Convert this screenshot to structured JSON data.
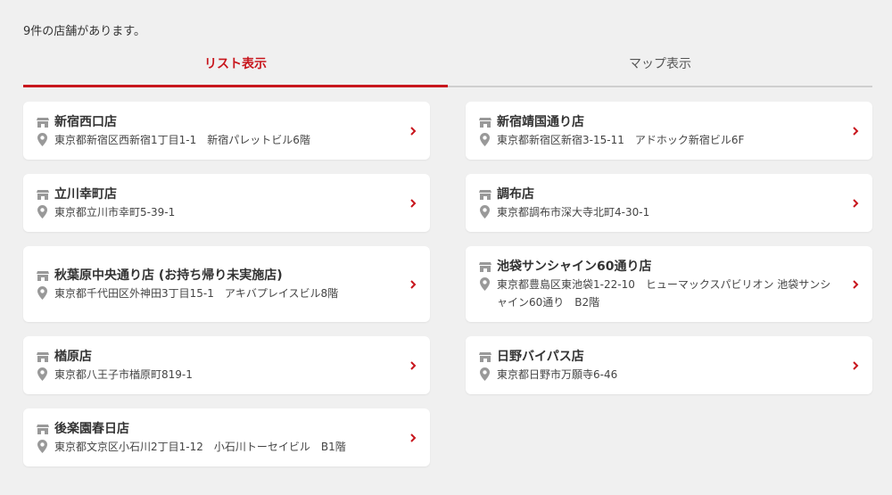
{
  "count_text": "9件の店舗があります。",
  "tabs": [
    {
      "label": "リスト表示",
      "active": true
    },
    {
      "label": "マップ表示",
      "active": false
    }
  ],
  "icons": {
    "store": "store-icon",
    "location": "location-pin-icon",
    "arrow": "chevron-right-icon"
  },
  "colors": {
    "accent": "#c8161d",
    "background": "#f0f0f0",
    "icon": "#999999"
  },
  "stores": [
    {
      "name": "新宿西口店",
      "address": "東京都新宿区西新宿1丁目1-1　新宿パレットビル6階"
    },
    {
      "name": "新宿靖国通り店",
      "address": "東京都新宿区新宿3-15-11　アドホック新宿ビル6F"
    },
    {
      "name": "立川幸町店",
      "address": "東京都立川市幸町5-39-1"
    },
    {
      "name": "調布店",
      "address": "東京都調布市深大寺北町4-30-1"
    },
    {
      "name": "秋葉原中央通り店 (お持ち帰り未実施店)",
      "address": "東京都千代田区外神田3丁目15-1　アキバプレイスビル8階"
    },
    {
      "name": "池袋サンシャイン60通り店",
      "address": "東京都豊島区東池袋1-22-10　ヒューマックスパビリオン 池袋サンシャイン60通り　B2階"
    },
    {
      "name": "楢原店",
      "address": "東京都八王子市楢原町819-1"
    },
    {
      "name": "日野バイパス店",
      "address": "東京都日野市万願寺6-46"
    },
    {
      "name": "後楽園春日店",
      "address": "東京都文京区小石川2丁目1-12　小石川トーセイビル　B1階"
    }
  ]
}
